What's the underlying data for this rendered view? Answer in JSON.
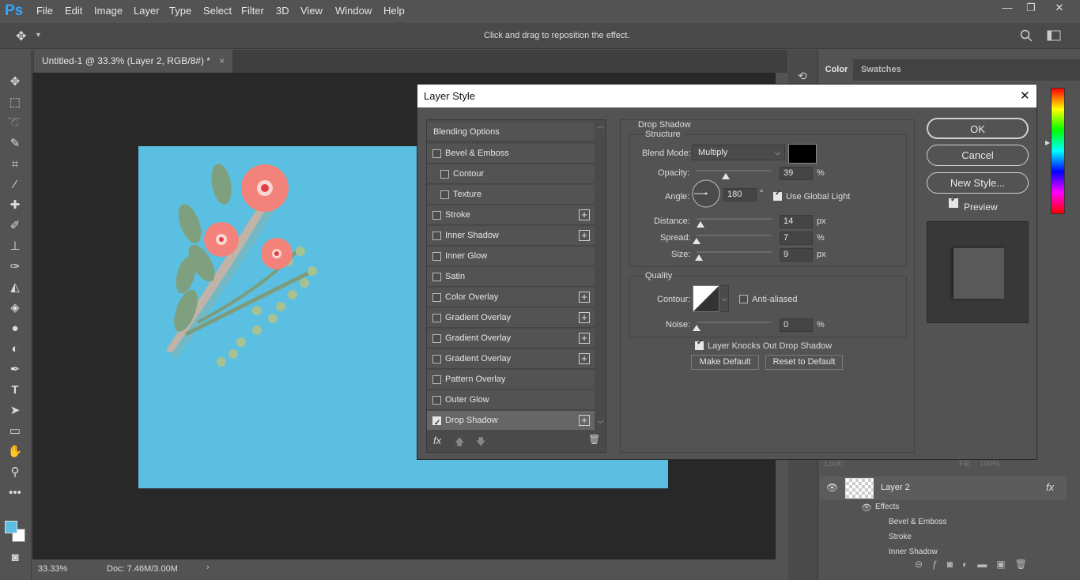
{
  "app": {
    "logo": "Ps",
    "menu": [
      "File",
      "Edit",
      "Image",
      "Layer",
      "Type",
      "Select",
      "Filter",
      "3D",
      "View",
      "Window",
      "Help"
    ]
  },
  "window_controls": {
    "minimize": "—",
    "restore": "❐",
    "close": "✕"
  },
  "options_bar": {
    "hint": "Click and drag to reposition the effect."
  },
  "document": {
    "tab_title": "Untitled-1 @ 33.3% (Layer 2, RGB/8#) *",
    "tab_close": "×"
  },
  "status": {
    "zoom": "33.33%",
    "doc": "Doc: 7.46M/3.00M"
  },
  "colors": {
    "artboard": "#5bbfe2",
    "foreground": "#5bbfe2",
    "background": "#ffffff",
    "arrow": "#ff0000"
  },
  "right_panel": {
    "tabs": [
      "Color",
      "Swatches"
    ],
    "layers_row": {
      "locks": "Lock:",
      "fill": "Fill:",
      "fill_value": "100%"
    },
    "layer_name": "Layer 2",
    "layer_fx": "fx",
    "effects_label": "Effects",
    "effects": [
      "Bevel & Emboss",
      "Stroke",
      "Inner Shadow"
    ]
  },
  "dialog": {
    "title": "Layer Style",
    "close": "✕",
    "styles": [
      {
        "label": "Blending Options",
        "checkbox": false,
        "checked": false,
        "plus": false,
        "indent": false,
        "header": true
      },
      {
        "label": "Bevel & Emboss",
        "checkbox": true,
        "checked": false,
        "plus": false,
        "indent": false
      },
      {
        "label": "Contour",
        "checkbox": true,
        "checked": false,
        "plus": false,
        "indent": true
      },
      {
        "label": "Texture",
        "checkbox": true,
        "checked": false,
        "plus": false,
        "indent": true
      },
      {
        "label": "Stroke",
        "checkbox": true,
        "checked": false,
        "plus": true,
        "indent": false
      },
      {
        "label": "Inner Shadow",
        "checkbox": true,
        "checked": false,
        "plus": true,
        "indent": false
      },
      {
        "label": "Inner Glow",
        "checkbox": true,
        "checked": false,
        "plus": false,
        "indent": false
      },
      {
        "label": "Satin",
        "checkbox": true,
        "checked": false,
        "plus": false,
        "indent": false
      },
      {
        "label": "Color Overlay",
        "checkbox": true,
        "checked": false,
        "plus": true,
        "indent": false
      },
      {
        "label": "Gradient Overlay",
        "checkbox": true,
        "checked": false,
        "plus": true,
        "indent": false
      },
      {
        "label": "Gradient Overlay",
        "checkbox": true,
        "checked": false,
        "plus": true,
        "indent": false
      },
      {
        "label": "Gradient Overlay",
        "checkbox": true,
        "checked": false,
        "plus": true,
        "indent": false
      },
      {
        "label": "Pattern Overlay",
        "checkbox": true,
        "checked": false,
        "plus": false,
        "indent": false
      },
      {
        "label": "Outer Glow",
        "checkbox": true,
        "checked": false,
        "plus": false,
        "indent": false
      },
      {
        "label": "Drop Shadow",
        "checkbox": true,
        "checked": true,
        "plus": true,
        "indent": false,
        "selected": true
      }
    ],
    "list_footer": {
      "fx": "fx"
    },
    "drop_shadow": {
      "title": "Drop Shadow",
      "structure": "Structure",
      "blend_mode_label": "Blend Mode:",
      "blend_mode": "Multiply",
      "shadow_color": "#000000",
      "opacity_label": "Opacity:",
      "opacity": "39",
      "opacity_unit": "%",
      "opacity_level": 0.39,
      "angle_label": "Angle:",
      "angle": "180",
      "angle_unit": "°",
      "use_global_light": "Use Global Light",
      "distance_label": "Distance:",
      "distance": "14",
      "distance_unit": "px",
      "distance_level": 0.05,
      "spread_label": "Spread:",
      "spread": "7",
      "spread_unit": "%",
      "spread_level": 0.0,
      "size_label": "Size:",
      "size": "9",
      "size_unit": "px",
      "size_level": 0.03,
      "quality": "Quality",
      "contour_label": "Contour:",
      "anti_aliased": "Anti-aliased",
      "noise_label": "Noise:",
      "noise": "0",
      "noise_unit": "%",
      "noise_level": 0.0,
      "knockout": "Layer Knocks Out Drop Shadow",
      "make_default": "Make Default",
      "reset_default": "Reset to Default"
    },
    "buttons": {
      "ok": "OK",
      "cancel": "Cancel",
      "new_style": "New Style...",
      "preview": "Preview"
    }
  }
}
